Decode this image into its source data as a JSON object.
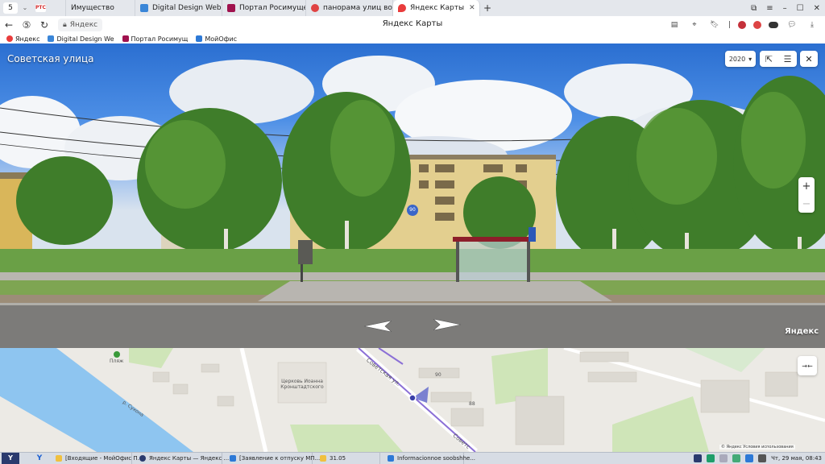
{
  "browser": {
    "tab_counter": "5",
    "tabs": [
      {
        "label": "РТС",
        "fav_color": "#ffffff",
        "fav_text_color": "#d42b2b"
      },
      {
        "label": "Имущество",
        "fav_color": "#ffffff"
      },
      {
        "label": "Digital Design Web Client",
        "fav_color": "#3a86d8"
      },
      {
        "label": "Портал Росимущества",
        "fav_color": "#a0124e"
      },
      {
        "label": "панорама улиц волого…",
        "fav_color": "#e04343"
      },
      {
        "label": "Яндекс Карты",
        "fav_color": "#e93c3c"
      }
    ],
    "address": "Яндекс",
    "page_title": "Яндекс Карты",
    "bookmarks": [
      {
        "label": "Яндекс",
        "color": "#e93c3c"
      },
      {
        "label": "Digital Design We",
        "color": "#3a86d8"
      },
      {
        "label": "Портал Росимущ",
        "color": "#a0124e"
      },
      {
        "label": "МойОфис",
        "color": "#2d79d6"
      }
    ]
  },
  "panorama": {
    "street_name": "Советская улица",
    "year": "2020",
    "watermark": "Яндекс",
    "house_number": "90"
  },
  "map": {
    "labels": {
      "street": "Советская ул.",
      "street2": "Советс",
      "church": "Церковь Иоанна Кронштадтского",
      "beach": "Пляж",
      "river": "р. Сухона",
      "house1": "90",
      "house2": "88"
    },
    "copyright": "© Яндекс   Условия использования"
  },
  "taskbar": {
    "start": "Y",
    "lang": "Y",
    "items": [
      {
        "label": "[Входящие - МойОфис П...",
        "color": "#f0c040"
      },
      {
        "label": "Яндекс Карты — Яндекс ...",
        "color": "#2a3a6e"
      },
      {
        "label": "[Заявление к отпуску МП...",
        "color": "#2d79d6"
      },
      {
        "label": "31.05",
        "color": "#f0c040"
      },
      {
        "label": "Informacionnoe soobshhe...",
        "color": "#2d79d6"
      }
    ],
    "clock": "Чт, 29 мая, 08:43"
  }
}
